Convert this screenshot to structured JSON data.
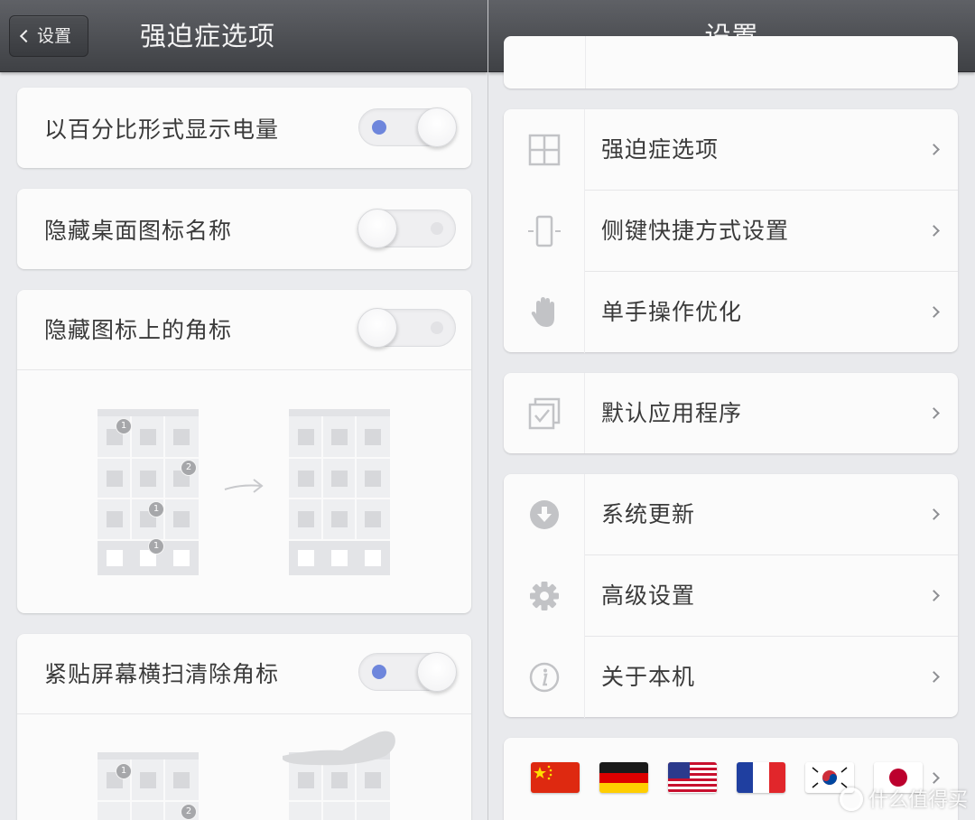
{
  "left": {
    "title": "强迫症选项",
    "back_label": "设置",
    "rows": [
      {
        "label": "以百分比形式显示电量",
        "on": true
      },
      {
        "label": "隐藏桌面图标名称",
        "on": false
      },
      {
        "label": "隐藏图标上的角标",
        "on": false
      },
      {
        "label": "紧贴屏幕横扫清除角标",
        "on": true
      }
    ],
    "badges": [
      "1",
      "2",
      "1",
      "1"
    ],
    "badges2": [
      "1",
      "2"
    ]
  },
  "right": {
    "title": "设置",
    "group1": [
      {
        "label": "强迫症选项",
        "icon": "grid-icon"
      },
      {
        "label": "侧键快捷方式设置",
        "icon": "phone-side-key-icon"
      },
      {
        "label": "单手操作优化",
        "icon": "hand-icon"
      }
    ],
    "group2": [
      {
        "label": "默认应用程序",
        "icon": "default-app-icon"
      }
    ],
    "group3": [
      {
        "label": "系统更新",
        "icon": "download-icon"
      },
      {
        "label": "高级设置",
        "icon": "gear-icon"
      },
      {
        "label": "关于本机",
        "icon": "info-icon"
      }
    ],
    "flags": [
      "china-flag",
      "germany-flag",
      "usa-flag",
      "france-flag",
      "korea-flag",
      "japan-flag"
    ]
  },
  "watermark": "什么值得买"
}
